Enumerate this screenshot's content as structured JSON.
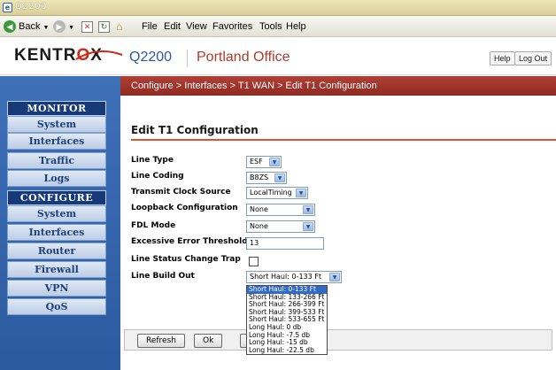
{
  "window": {
    "title": "Q2200"
  },
  "toolbar": {
    "back_label": "Back",
    "menus": [
      "File",
      "Edit",
      "View",
      "Favorites",
      "Tools",
      "Help"
    ]
  },
  "header": {
    "logo_text_a": "KENTR",
    "logo_text_x": "O",
    "logo_text_b": "X",
    "product": "Q2200",
    "site": "Portland Office",
    "help_label": "Help",
    "logout_label": "Log Out"
  },
  "sidebar": {
    "monitor_header": "MONITOR",
    "monitor_items": [
      "System",
      "Interfaces",
      "Traffic",
      "Logs"
    ],
    "configure_header": "CONFIGURE",
    "configure_items": [
      "System",
      "Interfaces",
      "Router",
      "Firewall",
      "VPN",
      "QoS"
    ]
  },
  "breadcrumb": "Configure >  Interfaces  >  T1 WAN  > Edit T1 Configuration",
  "form": {
    "title": "Edit T1 Configuration",
    "fields": [
      {
        "label": "Line Type",
        "value": "ESF"
      },
      {
        "label": "Line Coding",
        "value": "B8ZS"
      },
      {
        "label": "Transmit Clock Source",
        "value": "LocalTiming"
      },
      {
        "label": "Loopback Configuration",
        "value": "None"
      },
      {
        "label": "FDL Mode",
        "value": "None"
      },
      {
        "label": "Excessive Error Threshold",
        "value": "13"
      },
      {
        "label": "Line Status Change Trap",
        "value": ""
      },
      {
        "label": "Line Build Out",
        "value": "Short Haul: 0-133 Ft"
      }
    ],
    "line_build_out_options": [
      "Short Haul: 0-133 Ft",
      "Short Haul: 133-266 Ft",
      "Short Haul: 266-399 Ft",
      "Short Haul: 399-533 Ft",
      "Short Haul: 533-655 Ft",
      "Long Haul: 0 db",
      "Long Haul: -7.5 db",
      "Long Haul: -15 db",
      "Long Haul: -22.5 db"
    ],
    "refresh_label": "Refresh",
    "ok_label": "Ok"
  }
}
